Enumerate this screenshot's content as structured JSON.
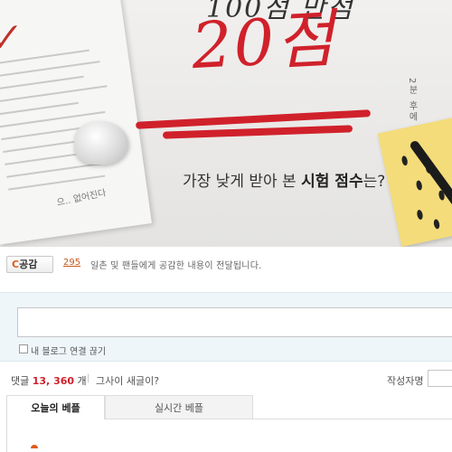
{
  "banner": {
    "score_top": "100점 만점",
    "score": "20점",
    "headline_pre": "가장 낮게 받아 본 ",
    "headline_bold": "시험 점수",
    "headline_post": "는?",
    "scribble_right": "2분 후에",
    "scribble_left": "으.. 없어진다",
    "accent": "#d0212b"
  },
  "sympathy": {
    "button_prefix": "C",
    "button_label": "공감",
    "count": "295",
    "text": "일촌 및 팬들에게 공감한 내용이 전달됩니다."
  },
  "comment_form": {
    "input_value": "",
    "checkbox_label": "내 블로그 연결 끊기",
    "checkbox_checked": false
  },
  "comments_header": {
    "label": "댓글",
    "count": "13, 360",
    "unit": "개",
    "separator": "|",
    "new_link": "그사이 새글이?",
    "author_label": "작성자명"
  },
  "tabs": [
    {
      "label": "오늘의 베플",
      "active": true
    },
    {
      "label": "실시간 베플",
      "active": false
    }
  ]
}
